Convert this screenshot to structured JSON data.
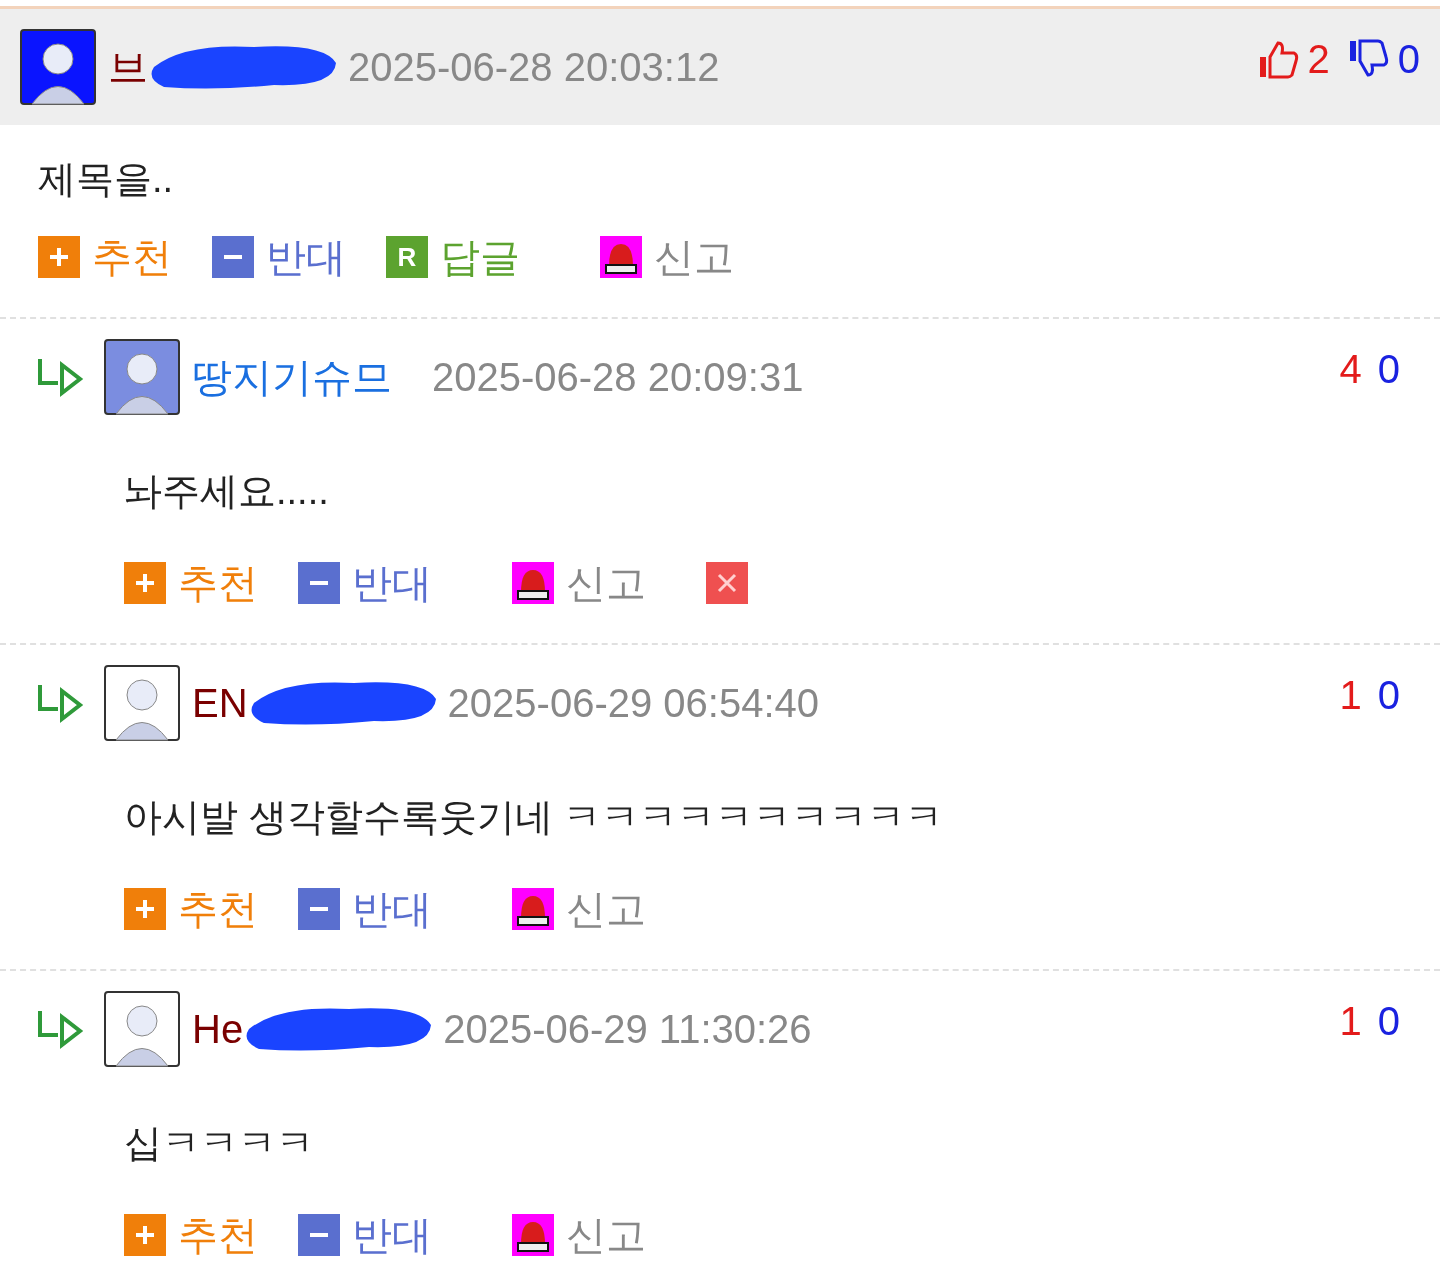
{
  "comments": [
    {
      "kind": "post",
      "username": "브",
      "is_author": false,
      "redacted": true,
      "time": "2025-06-28 20:03:12",
      "up": "2",
      "down": "0",
      "body": "제목을..",
      "actions": [
        {
          "kind": "recommend",
          "label": "추천"
        },
        {
          "kind": "oppose",
          "label": "반대"
        },
        {
          "kind": "reply",
          "label": "답글",
          "icon_text": "R"
        },
        {
          "kind": "report",
          "label": "신고"
        }
      ]
    },
    {
      "kind": "reply",
      "username": "땅지기슈므",
      "is_author": true,
      "redacted": false,
      "time": "2025-06-28 20:09:31",
      "up": "4",
      "down": "0",
      "body": "놔주세요.....",
      "actions": [
        {
          "kind": "recommend",
          "label": "추천"
        },
        {
          "kind": "oppose",
          "label": "반대"
        },
        {
          "kind": "report",
          "label": "신고"
        },
        {
          "kind": "delete"
        }
      ]
    },
    {
      "kind": "reply",
      "username": "EN",
      "is_author": false,
      "redacted": true,
      "time": "2025-06-29 06:54:40",
      "up": "1",
      "down": "0",
      "body": "아시발 생각할수록웃기네 ㅋㅋㅋㅋㅋㅋㅋㅋㅋㅋ",
      "actions": [
        {
          "kind": "recommend",
          "label": "추천"
        },
        {
          "kind": "oppose",
          "label": "반대"
        },
        {
          "kind": "report",
          "label": "신고"
        }
      ]
    },
    {
      "kind": "reply",
      "username": "He",
      "is_author": false,
      "redacted": true,
      "time": "2025-06-29 11:30:26",
      "up": "1",
      "down": "0",
      "body": "십ㅋㅋㅋㅋ",
      "actions": [
        {
          "kind": "recommend",
          "label": "추천"
        },
        {
          "kind": "oppose",
          "label": "반대"
        },
        {
          "kind": "report",
          "label": "신고"
        }
      ]
    }
  ]
}
